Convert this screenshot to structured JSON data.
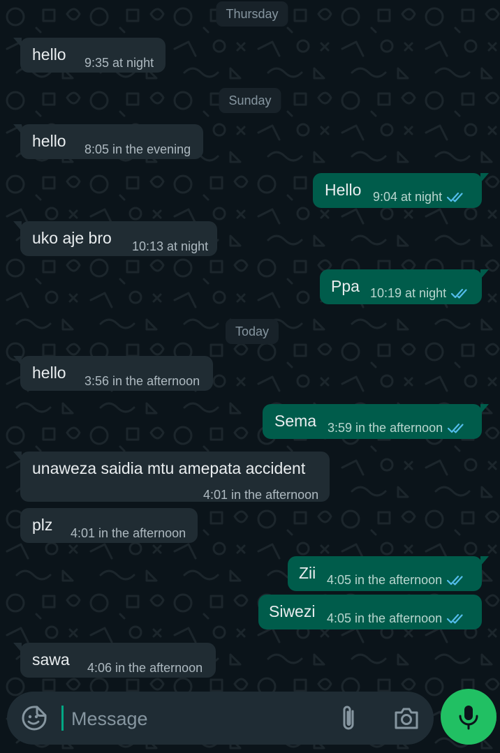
{
  "theme": {
    "incoming_bubble": "#202c33",
    "outgoing_bubble": "#005c4b",
    "read_tick_color": "#53bdeb",
    "accent": "#21c063"
  },
  "days": [
    {
      "label": "Thursday"
    },
    {
      "label": "Sunday"
    },
    {
      "label": "Today"
    }
  ],
  "messages": [
    {
      "text": "hello",
      "time": "9:35 at night",
      "direction": "incoming"
    },
    {
      "text": "hello",
      "time": "8:05 in the evening",
      "direction": "incoming"
    },
    {
      "text": "Hello",
      "time": "9:04 at night",
      "direction": "outgoing",
      "status": "read"
    },
    {
      "text": "uko aje bro",
      "time": "10:13 at night",
      "direction": "incoming"
    },
    {
      "text": "Ppa",
      "time": "10:19 at night",
      "direction": "outgoing",
      "status": "read"
    },
    {
      "text": "hello",
      "time": "3:56 in the afternoon",
      "direction": "incoming"
    },
    {
      "text": "Sema",
      "time": "3:59 in the afternoon",
      "direction": "outgoing",
      "status": "read"
    },
    {
      "text": "unaweza saidia mtu amepata accident",
      "time": "4:01 in the afternoon",
      "direction": "incoming"
    },
    {
      "text": "plz",
      "time": "4:01 in the afternoon",
      "direction": "incoming"
    },
    {
      "text": "Zii",
      "time": "4:05 in the afternoon",
      "direction": "outgoing",
      "status": "read"
    },
    {
      "text": "Siwezi",
      "time": "4:05 in the afternoon",
      "direction": "outgoing",
      "status": "read"
    },
    {
      "text": "sawa",
      "time": "4:06 in the afternoon",
      "direction": "incoming"
    }
  ],
  "composer": {
    "placeholder": "Message",
    "value": "",
    "icons": [
      "sticker-icon",
      "paperclip-icon",
      "camera-icon",
      "microphone-icon"
    ]
  }
}
